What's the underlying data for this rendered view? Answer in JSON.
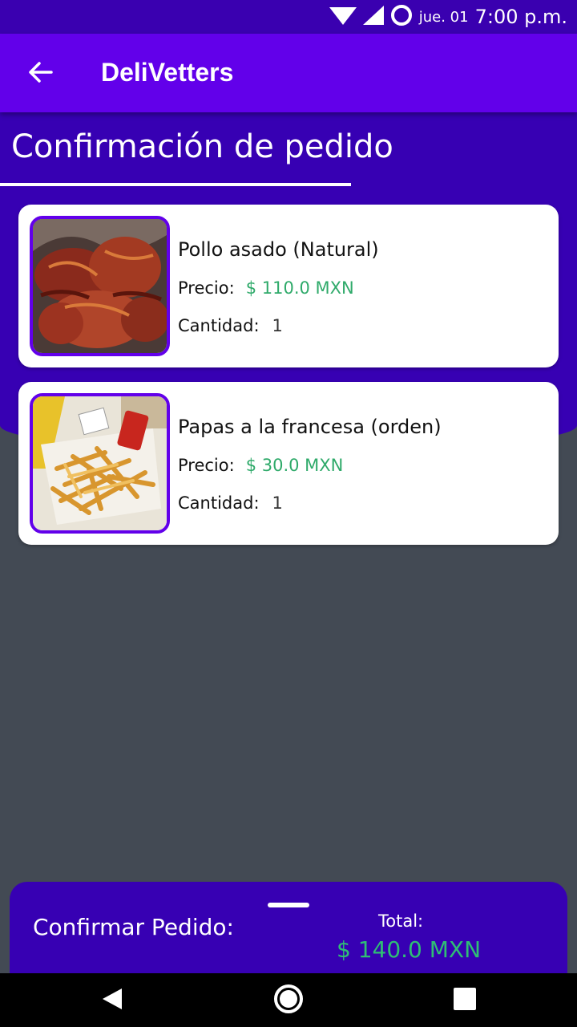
{
  "status_bar": {
    "date": "jue. 01",
    "time": "7:00 p.m.",
    "icons": [
      "wifi-icon",
      "signal-icon",
      "battery-icon"
    ]
  },
  "app_bar": {
    "title": "DeliVetters",
    "back_icon": "arrow-left-icon"
  },
  "page": {
    "title": "Confirmación de pedido"
  },
  "order_items": [
    {
      "name": "Pollo asado (Natural)",
      "price_label": "Precio:",
      "price": "$  110.0 MXN",
      "quantity_label": "Cantidad:",
      "quantity": "1",
      "image": "grilled-chicken-photo"
    },
    {
      "name": "Papas a la francesa (orden)",
      "price_label": "Precio:",
      "price": "$  30.0 MXN",
      "quantity_label": "Cantidad:",
      "quantity": "1",
      "image": "french-fries-photo"
    }
  ],
  "bottom_sheet": {
    "confirm_label": "Confirmar Pedido:",
    "total_label": "Total:",
    "total_value": "$ 140.0 MXN"
  },
  "nav_bar": {
    "icons": [
      "back-triangle-icon",
      "home-circle-icon",
      "recents-square-icon"
    ]
  },
  "colors": {
    "primary": "#6200ea",
    "primary_dark": "#3700b3",
    "price_green": "#2faa6a",
    "background": "#434a54"
  }
}
